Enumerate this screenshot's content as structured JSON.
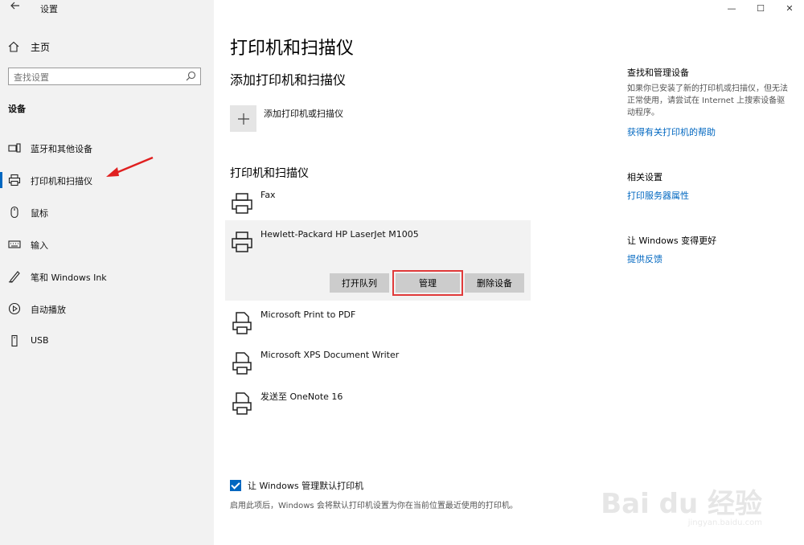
{
  "window": {
    "title": "设置",
    "controls": {
      "minimize": "—",
      "maximize": "☐",
      "close": "✕"
    }
  },
  "sidebar": {
    "home_label": "主页",
    "search_placeholder": "查找设置",
    "section_label": "设备",
    "items": [
      {
        "label": "蓝牙和其他设备",
        "icon": "devices-icon"
      },
      {
        "label": "打印机和扫描仪",
        "icon": "printer-icon",
        "active": true
      },
      {
        "label": "鼠标",
        "icon": "mouse-icon"
      },
      {
        "label": "输入",
        "icon": "keyboard-icon"
      },
      {
        "label": "笔和 Windows Ink",
        "icon": "pen-icon"
      },
      {
        "label": "自动播放",
        "icon": "autoplay-icon"
      },
      {
        "label": "USB",
        "icon": "usb-icon"
      }
    ]
  },
  "main": {
    "page_title": "打印机和扫描仪",
    "add_section_title": "添加打印机和扫描仪",
    "add_button_label": "添加打印机或扫描仪",
    "list_section_title": "打印机和扫描仪",
    "printers": [
      {
        "name": "Fax"
      },
      {
        "name": "Hewlett-Packard HP LaserJet M1005",
        "selected": true
      },
      {
        "name": "Microsoft Print to PDF"
      },
      {
        "name": "Microsoft XPS Document Writer"
      },
      {
        "name": "发送至 OneNote 16"
      }
    ],
    "actions": {
      "open_queue": "打开队列",
      "manage": "管理",
      "remove": "删除设备"
    },
    "default_printer": {
      "checked": true,
      "label": "让 Windows 管理默认打印机",
      "description": "启用此项后，Windows 会将默认打印机设置为你在当前位置最近使用的打印机。"
    }
  },
  "right_panel": {
    "find_title": "查找和管理设备",
    "find_text": "如果你已安装了新的打印机或扫描仪，但无法正常使用，请尝试在 Internet 上搜索设备驱动程序。",
    "find_link": "获得有关打印机的帮助",
    "related_title": "相关设置",
    "related_link": "打印服务器属性",
    "improve_title": "让 Windows 变得更好",
    "improve_link": "提供反馈"
  },
  "watermark": {
    "brand": "Bai du 经验",
    "url": "jingyan.baidu.com"
  },
  "colors": {
    "accent": "#0067c0",
    "highlight_outline": "#e03a3a",
    "sidebar_bg": "#f2f2f2"
  }
}
